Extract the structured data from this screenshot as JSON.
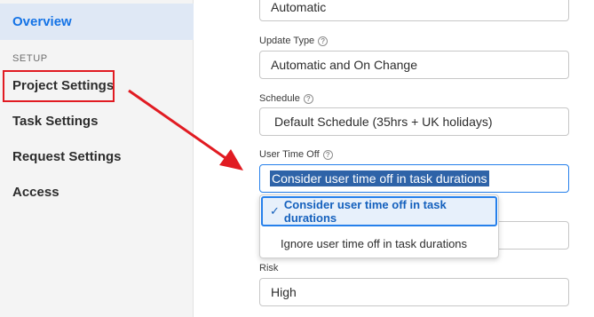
{
  "sidebar": {
    "active_item": "Overview",
    "section_label": "SETUP",
    "items": [
      "Project Settings",
      "Task Settings",
      "Request Settings",
      "Access"
    ]
  },
  "form": {
    "first_value": "Automatic",
    "update_type": {
      "label": "Update Type",
      "value": "Automatic and On Change"
    },
    "schedule": {
      "label": "Schedule",
      "value": "Default Schedule (35hrs + UK holidays)"
    },
    "user_time_off": {
      "label": "User Time Off",
      "value": "Consider user time off in task durations",
      "options": [
        "Consider user time off in task durations",
        "Ignore user time off in task durations"
      ]
    },
    "risk": {
      "label": "Risk",
      "value": "High"
    }
  },
  "help_icon": "?",
  "check_mark": "✓",
  "colors": {
    "accent": "#1473e6",
    "annotation": "#e11b22",
    "selection": "#2e63a8"
  }
}
